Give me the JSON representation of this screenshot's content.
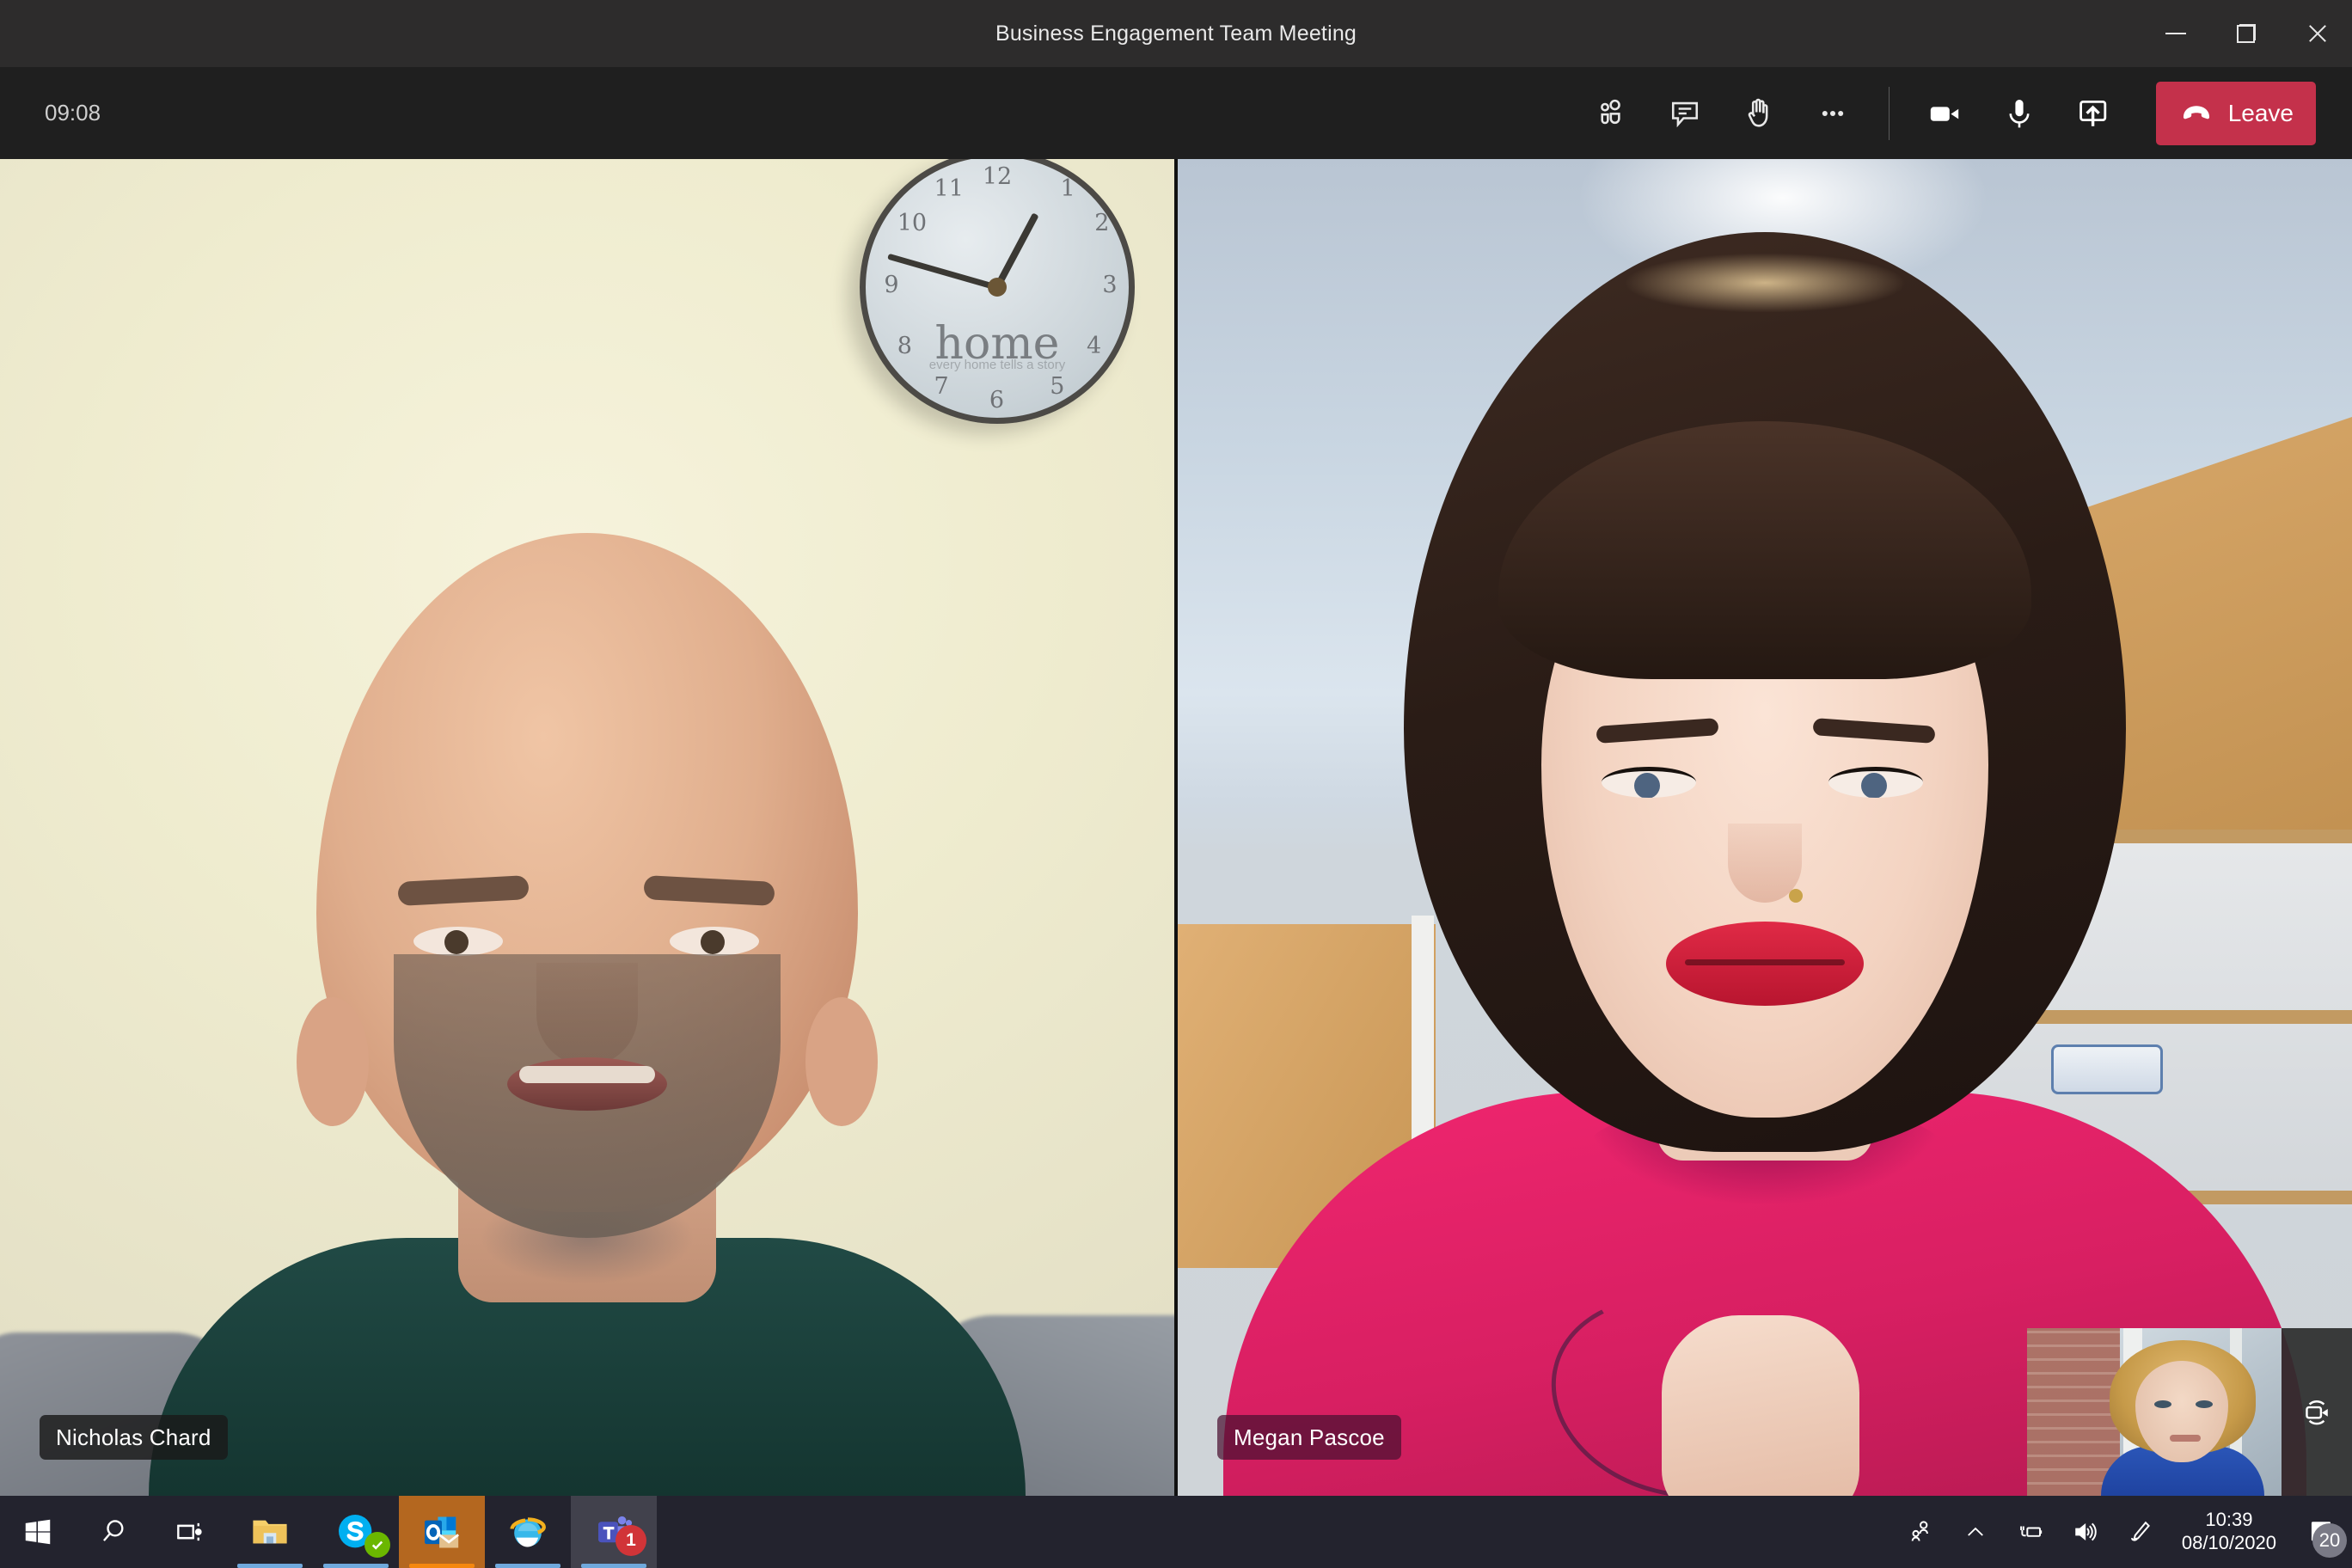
{
  "window": {
    "title": "Business Engagement Team Meeting",
    "controls": {
      "minimize": "Minimize",
      "restore": "Restore",
      "close": "Close"
    }
  },
  "meeting": {
    "elapsed_time": "09:08",
    "toolbar": {
      "show_participants": "Show participants",
      "show_conversation": "Show conversation",
      "raise_hand": "Raise your hand",
      "more_actions": "More actions",
      "camera": "Turn camera off",
      "microphone": "Mute",
      "share": "Share content",
      "leave_label": "Leave"
    },
    "accent_colors": {
      "leave_button": "#C4314B",
      "toolbar_bg": "#1F1F1F",
      "titlebar_bg": "#2D2C2C"
    },
    "participants": [
      {
        "name": "Nicholas Chard",
        "position": "left"
      },
      {
        "name": "Megan Pascoe",
        "position": "right"
      }
    ],
    "self_view": {
      "switch_camera_label": "Switch camera"
    },
    "wall_clock": {
      "brand_text": "home",
      "tagline": "every home tells a story",
      "numbers": [
        "12",
        "1",
        "2",
        "3",
        "4",
        "5",
        "6",
        "7",
        "8",
        "9",
        "10",
        "11"
      ]
    }
  },
  "taskbar": {
    "items": [
      {
        "name": "start",
        "label": "Start"
      },
      {
        "name": "search",
        "label": "Search"
      },
      {
        "name": "task-view",
        "label": "Task View"
      },
      {
        "name": "file-explorer",
        "label": "File Explorer"
      },
      {
        "name": "skype",
        "label": "Skype"
      },
      {
        "name": "outlook",
        "label": "Outlook"
      },
      {
        "name": "internet-explorer",
        "label": "Internet Explorer"
      },
      {
        "name": "microsoft-teams",
        "label": "Microsoft Teams",
        "badge": "1"
      }
    ],
    "tray": {
      "people": "People",
      "show_hidden": "Show hidden icons",
      "power": "Power",
      "volume": "Volume",
      "pen": "Windows Ink Workspace",
      "time": "10:39",
      "date": "08/10/2020",
      "notification_count": "20"
    }
  }
}
